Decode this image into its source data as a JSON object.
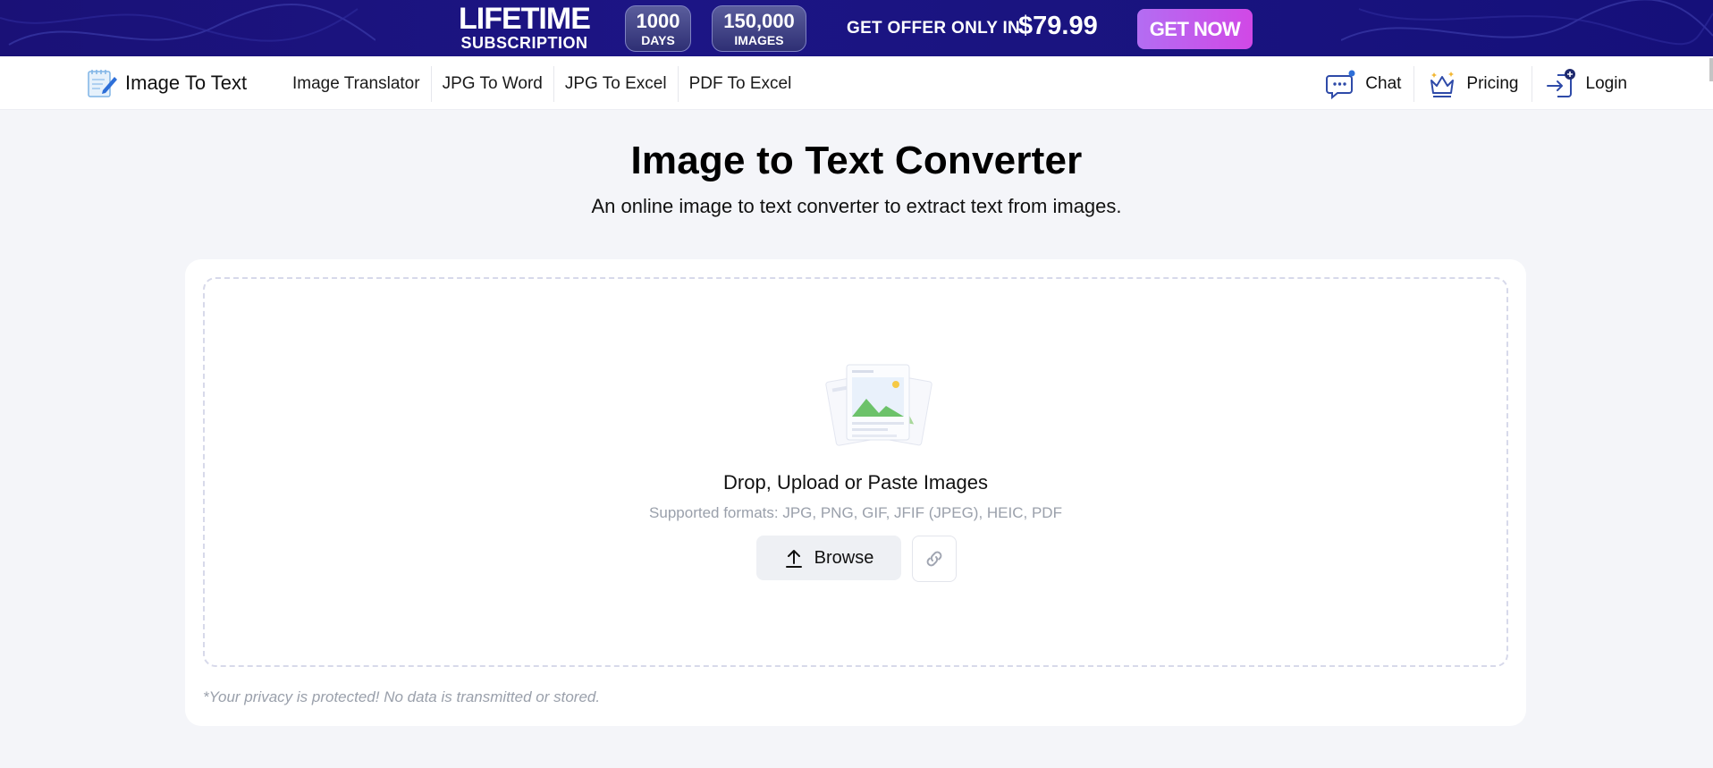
{
  "promo": {
    "title": "LIFETIME",
    "subtitle": "SUBSCRIPTION",
    "pill1_number": "1000",
    "pill1_label": "DAYS",
    "pill2_number": "150,000",
    "pill2_label": "IMAGES",
    "offer_text": "GET OFFER ONLY IN",
    "price": "$79.99",
    "cta": "GET NOW"
  },
  "nav": {
    "logo_text": "Image To Text",
    "links": [
      {
        "label": "Image Translator"
      },
      {
        "label": "JPG To Word"
      },
      {
        "label": "JPG To Excel"
      },
      {
        "label": "PDF To Excel"
      }
    ],
    "chat_label": "Chat",
    "pricing_label": "Pricing",
    "login_label": "Login"
  },
  "main": {
    "title": "Image to Text Converter",
    "subtitle": "An online image to text converter to extract text from images."
  },
  "upload": {
    "title": "Drop, Upload or Paste Images",
    "formats": "Supported formats: JPG, PNG, GIF, JFIF (JPEG), HEIC, PDF",
    "browse_label": "Browse",
    "privacy_note": "*Your privacy is protected! No data is transmitted or stored."
  },
  "icons": {
    "logo": "notepad-pencil-icon",
    "chat": "chat-bubble-icon",
    "pricing": "crown-icon",
    "login": "login-arrow-icon",
    "upload": "upload-arrow-icon",
    "link": "link-icon",
    "illustration": "images-stack-icon"
  },
  "colors": {
    "banner": "#1a1177",
    "cta_gradient_start": "#b36df2",
    "cta_gradient_end": "#d148e6",
    "icon_blue": "#2e4aa8",
    "page_bg": "#f4f5f9"
  }
}
